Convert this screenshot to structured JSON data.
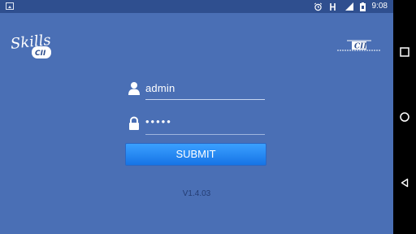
{
  "status_bar": {
    "time": "9:08"
  },
  "logos": {
    "left_logo_text_top": "Skills",
    "left_logo_text_bottom": "CII",
    "right_logo_text": "CII"
  },
  "form": {
    "username": {
      "value": "admin"
    },
    "password": {
      "value": "•••••"
    },
    "submit_label": "SUBMIT",
    "version": "V1.4.03"
  },
  "colors": {
    "screen_background": "#4a6fb5",
    "status_bar": "#2f4f8f",
    "button_top": "#3aa0ff",
    "button_bottom": "#1674e6",
    "version_text": "#243d73"
  },
  "icons": {
    "status": [
      "image-icon",
      "alarm-icon",
      "signal-h-icon",
      "cell-signal-icon",
      "battery-icon"
    ],
    "form": [
      "user-icon",
      "lock-icon"
    ],
    "nav": [
      "square-nav-icon",
      "circle-nav-icon",
      "back-triangle-icon"
    ]
  }
}
